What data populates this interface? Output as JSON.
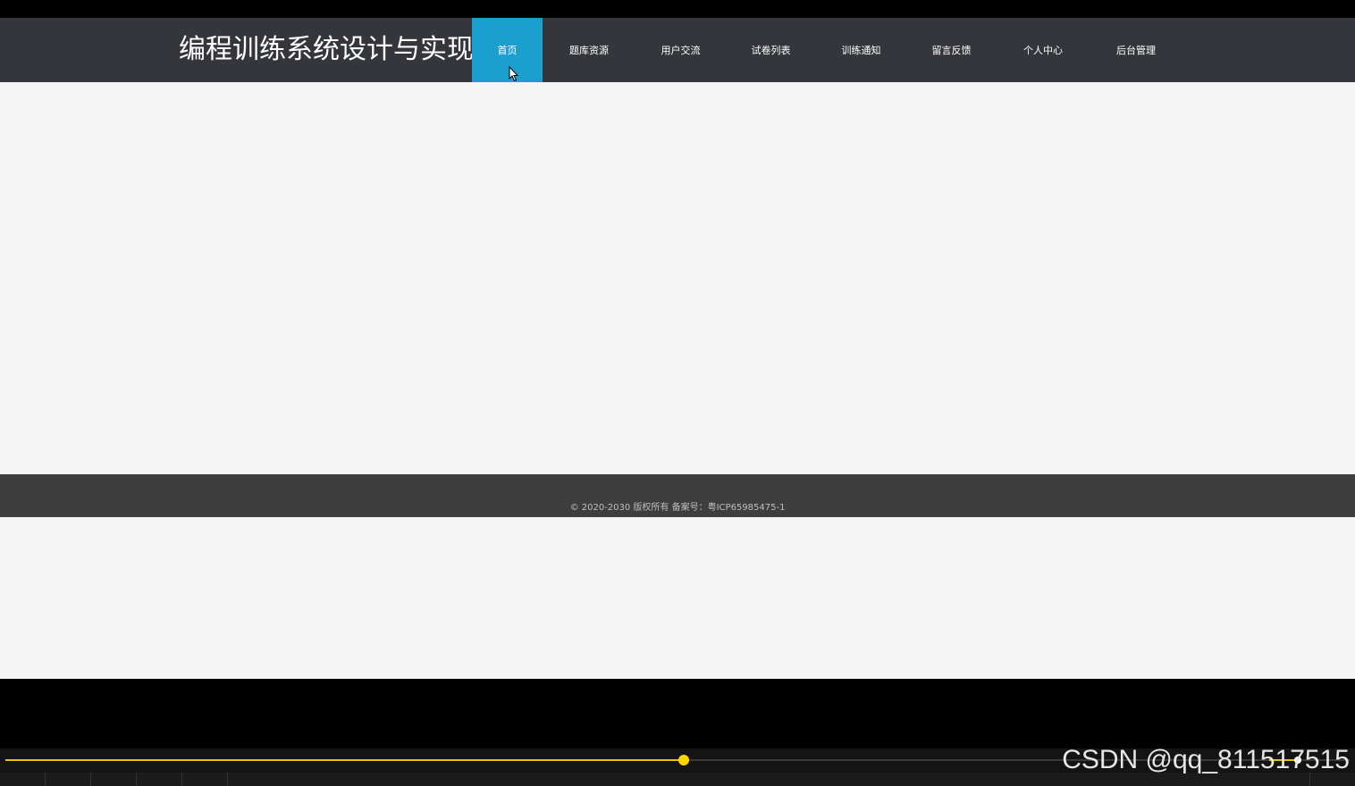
{
  "site": {
    "title": "编程训练系统设计与实现",
    "nav": [
      {
        "label": "首页",
        "active": true
      },
      {
        "label": "题库资源",
        "active": false
      },
      {
        "label": "用户交流",
        "active": false
      },
      {
        "label": "试卷列表",
        "active": false
      },
      {
        "label": "训练通知",
        "active": false
      },
      {
        "label": "留言反馈",
        "active": false
      },
      {
        "label": "个人中心",
        "active": false
      },
      {
        "label": "后台管理",
        "active": false
      }
    ],
    "footer": "© 2020-2030 版权所有 备案号：粤ICP65985475-1"
  },
  "player": {
    "progress": 0.507
  },
  "watermark": "CSDN @qq_811517515",
  "colors": {
    "header_bg": "#34363b",
    "nav_active_bg": "#1a9fcf",
    "footer_bg": "#3e3e3e",
    "progress": "#e8c400"
  }
}
